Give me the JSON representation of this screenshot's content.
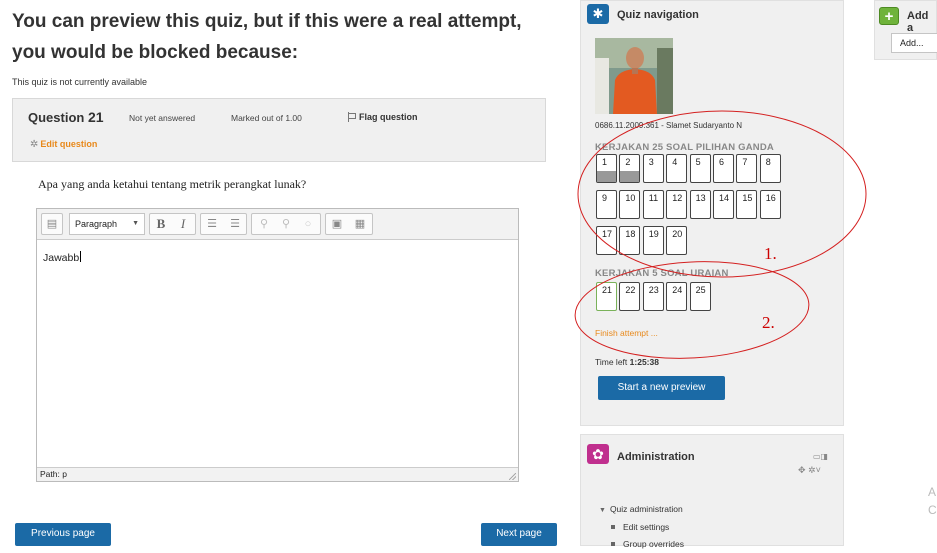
{
  "notice": {
    "title": "You can preview this quiz, but if this were a real attempt, you would be blocked because:",
    "reason": "This quiz is not currently available"
  },
  "question": {
    "label": "Question",
    "number": "21",
    "state": "Not yet answered",
    "marks": "Marked out of 1.00",
    "flag_label": "Flag question",
    "edit_label": "Edit question",
    "text": "Apa yang anda ketahui tentang metrik perangkat lunak?"
  },
  "editor": {
    "format": "Paragraph",
    "content": "Jawabb",
    "path": "Path: p"
  },
  "nav_buttons": {
    "prev": "Previous page",
    "next": "Next page"
  },
  "quiz_nav": {
    "title": "Quiz navigation",
    "user": "0686.11.2009.361 - Slamet Sudaryanto N",
    "section1": "KERJAKAN 25 SOAL PILIHAN GANDA",
    "section1_questions": [
      "1",
      "2",
      "3",
      "4",
      "5",
      "6",
      "7",
      "8",
      "9",
      "10",
      "11",
      "12",
      "13",
      "14",
      "15",
      "16",
      "17",
      "18",
      "19",
      "20"
    ],
    "answered": [
      "1",
      "2"
    ],
    "section2": "KERJAKAN 5 SOAL URAIAN",
    "section2_questions": [
      "21",
      "22",
      "23",
      "24",
      "25"
    ],
    "current": "21",
    "finish": "Finish attempt ...",
    "time_label": "Time left",
    "time_value": "1:25:38",
    "start_preview": "Start a new preview"
  },
  "administration": {
    "title": "Administration",
    "tree_root": "Quiz administration",
    "items": [
      "Edit settings",
      "Group overrides"
    ]
  },
  "add_block": {
    "title": "Add a",
    "select": "Add..."
  },
  "annotations": {
    "label1": "1.",
    "label2": "2."
  },
  "colors": {
    "primary_button": "#1b6aa6",
    "accent_orange": "#e8891b",
    "admin_icon": "#c02f8e",
    "add_icon": "#6fb33b",
    "annotation": "#cc0000"
  }
}
